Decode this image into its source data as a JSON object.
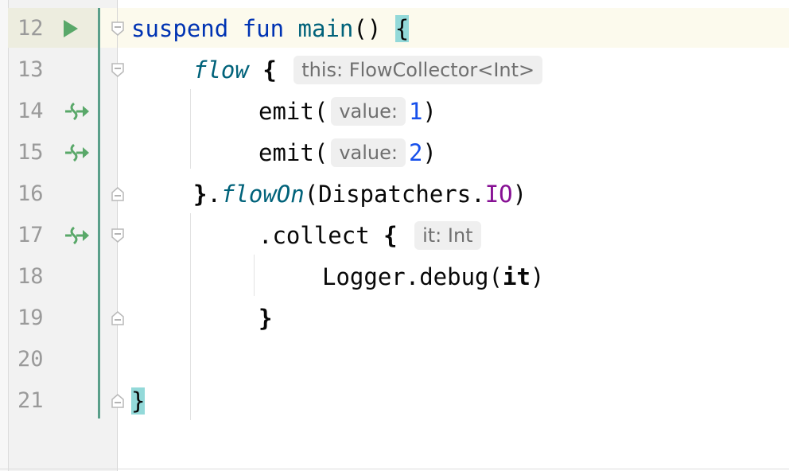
{
  "editor": {
    "lines": [
      {
        "number": "12",
        "code": {
          "kw1": "suspend",
          "kw2": "fun",
          "name": "main",
          "parens": "()",
          "brace": "{"
        }
      },
      {
        "number": "13",
        "code": {
          "flow": "flow",
          "brace": "{",
          "hint": "this: FlowCollector<Int>"
        }
      },
      {
        "number": "14",
        "code": {
          "call": "emit(",
          "hint": "value:",
          "value": "1",
          "close": ")"
        }
      },
      {
        "number": "15",
        "code": {
          "call": "emit(",
          "hint": "value:",
          "value": "2",
          "close": ")"
        }
      },
      {
        "number": "16",
        "code": {
          "brace": "}",
          "dot": ".",
          "flowOn": "flowOn",
          "open": "(Dispatchers.",
          "io": "IO",
          "close": ")"
        }
      },
      {
        "number": "17",
        "code": {
          "collect": ".collect",
          "brace": "{",
          "hint": "it: Int"
        }
      },
      {
        "number": "18",
        "code": {
          "call": "Logger.debug(",
          "it": "it",
          "close": ")"
        }
      },
      {
        "number": "19",
        "code": {
          "brace": "}"
        }
      },
      {
        "number": "20",
        "code": {}
      },
      {
        "number": "21",
        "code": {
          "brace": "}"
        }
      }
    ]
  },
  "colors": {
    "keyword": "#0033b3",
    "function": "#00627a",
    "number": "#1750eb",
    "constant": "#871094",
    "run_icon": "#59a869",
    "vcs_change": "#5a9f8a",
    "brace_match": "#93d9d9"
  },
  "icons": {
    "run": "run-gutter-icon",
    "suspend": "suspend-call-icon",
    "fold": "fold-marker-icon"
  }
}
